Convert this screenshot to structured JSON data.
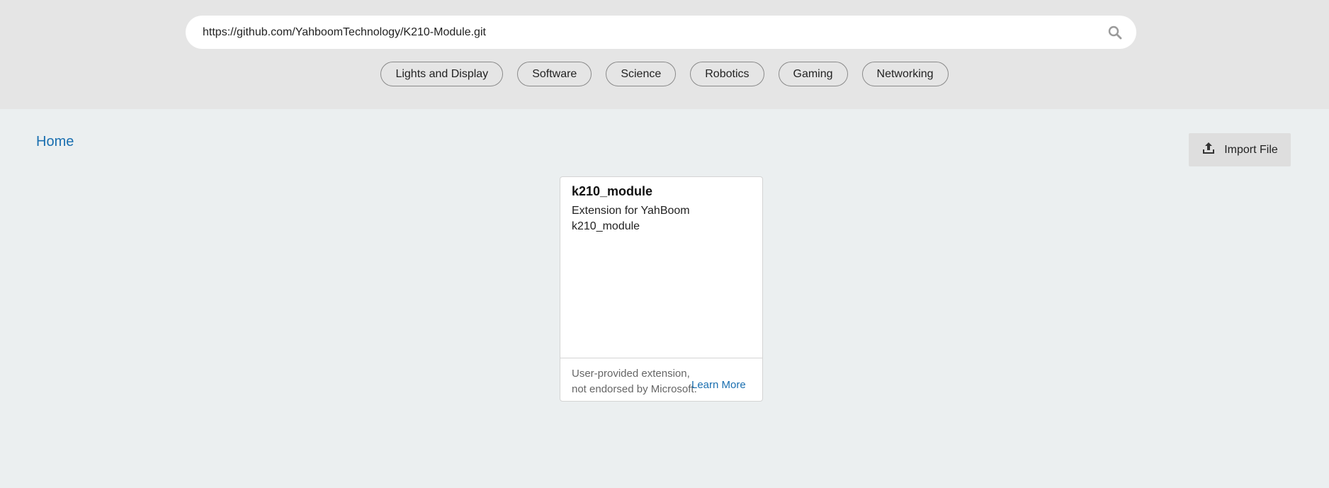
{
  "search": {
    "value": "https://github.com/YahboomTechnology/K210-Module.git",
    "icon": "search-icon"
  },
  "categories": [
    "Lights and Display",
    "Software",
    "Science",
    "Robotics",
    "Gaming",
    "Networking"
  ],
  "breadcrumb": {
    "home": "Home"
  },
  "import_button": {
    "label": "Import File",
    "icon": "upload-icon"
  },
  "card": {
    "title": "k210_module",
    "description": "Extension for YahBoom k210_module",
    "disclaimer": "User-provided extension, not endorsed by Microsoft.",
    "learn_more": "Learn More"
  },
  "colors": {
    "link": "#1a6fb0",
    "header_bg": "#e5e5e5",
    "page_bg": "#ebeff0"
  }
}
